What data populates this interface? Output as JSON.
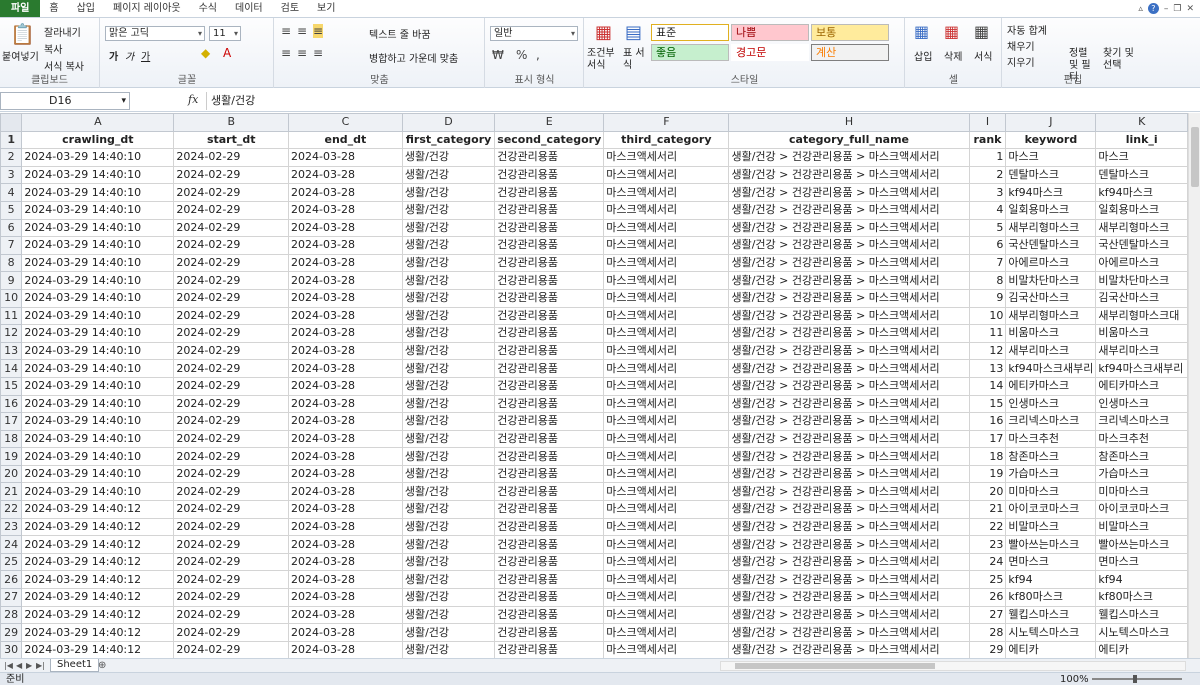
{
  "tabs": [
    "파일",
    "홈",
    "삽입",
    "페이지 레이아웃",
    "수식",
    "데이터",
    "검토",
    "보기"
  ],
  "ribbon": {
    "clipboard": {
      "paste": "붙여넣기",
      "cut": "잘라내기",
      "copy": "복사",
      "format_painter": "서식 복사",
      "label": "클립보드"
    },
    "font": {
      "name": "맑은 고딕",
      "size": "11",
      "bold": "가",
      "italic": "가",
      "underline": "가",
      "label": "글꼴"
    },
    "align": {
      "wrap": "텍스트 줄 바꿈",
      "merge": "병합하고 가운데 맞춤",
      "label": "맞춤"
    },
    "number": {
      "format": "일반",
      "label": "표시 형식"
    },
    "styles": {
      "conditional": "조건부 서식",
      "table": "표 서식",
      "normal": "표준",
      "bad": "나쁨",
      "neutral": "보통",
      "good": "좋음",
      "warning": "경고문",
      "calc": "계산",
      "label": "스타일"
    },
    "cells": {
      "insert": "삽입",
      "delete": "삭제",
      "format": "서식",
      "label": "셀"
    },
    "editing": {
      "autosum": "자동 합계",
      "fill": "채우기",
      "clear": "지우기",
      "sort": "정렬 및 필터",
      "find": "찾기 및 선택",
      "label": "편집"
    }
  },
  "formula_bar": {
    "name_box": "D16",
    "fx": "fx",
    "content": "생활/건강"
  },
  "columns": [
    "A",
    "B",
    "C",
    "D",
    "E",
    "F",
    "H",
    "I",
    "J",
    "K"
  ],
  "header_row": [
    "crawling_dt",
    "start_dt",
    "end_dt",
    "first_category",
    "second_category",
    "third_category",
    "category_full_name",
    "rank",
    "keyword",
    "link_i"
  ],
  "rows": [
    [
      "2024-03-29 14:40:10",
      "2024-02-29",
      "2024-03-28",
      "생활/건강",
      "건강관리용품",
      "마스크액세서리",
      "생활/건강 > 건강관리용품 > 마스크액세서리",
      "1",
      "마스크",
      "마스크"
    ],
    [
      "2024-03-29 14:40:10",
      "2024-02-29",
      "2024-03-28",
      "생활/건강",
      "건강관리용품",
      "마스크액세서리",
      "생활/건강 > 건강관리용품 > 마스크액세서리",
      "2",
      "덴탈마스크",
      "덴탈마스크"
    ],
    [
      "2024-03-29 14:40:10",
      "2024-02-29",
      "2024-03-28",
      "생활/건강",
      "건강관리용품",
      "마스크액세서리",
      "생활/건강 > 건강관리용품 > 마스크액세서리",
      "3",
      "kf94마스크",
      "kf94마스크"
    ],
    [
      "2024-03-29 14:40:10",
      "2024-02-29",
      "2024-03-28",
      "생활/건강",
      "건강관리용품",
      "마스크액세서리",
      "생활/건강 > 건강관리용품 > 마스크액세서리",
      "4",
      "일회용마스크",
      "일회용마스크"
    ],
    [
      "2024-03-29 14:40:10",
      "2024-02-29",
      "2024-03-28",
      "생활/건강",
      "건강관리용품",
      "마스크액세서리",
      "생활/건강 > 건강관리용품 > 마스크액세서리",
      "5",
      "새부리형마스크",
      "새부리형마스크"
    ],
    [
      "2024-03-29 14:40:10",
      "2024-02-29",
      "2024-03-28",
      "생활/건강",
      "건강관리용품",
      "마스크액세서리",
      "생활/건강 > 건강관리용품 > 마스크액세서리",
      "6",
      "국산덴탈마스크",
      "국산덴탈마스크"
    ],
    [
      "2024-03-29 14:40:10",
      "2024-02-29",
      "2024-03-28",
      "생활/건강",
      "건강관리용품",
      "마스크액세서리",
      "생활/건강 > 건강관리용품 > 마스크액세서리",
      "7",
      "아에르마스크",
      "아에르마스크"
    ],
    [
      "2024-03-29 14:40:10",
      "2024-02-29",
      "2024-03-28",
      "생활/건강",
      "건강관리용품",
      "마스크액세서리",
      "생활/건강 > 건강관리용품 > 마스크액세서리",
      "8",
      "비말차단마스크",
      "비말차단마스크"
    ],
    [
      "2024-03-29 14:40:10",
      "2024-02-29",
      "2024-03-28",
      "생활/건강",
      "건강관리용품",
      "마스크액세서리",
      "생활/건강 > 건강관리용품 > 마스크액세서리",
      "9",
      "김국산마스크",
      "김국산마스크"
    ],
    [
      "2024-03-29 14:40:10",
      "2024-02-29",
      "2024-03-28",
      "생활/건강",
      "건강관리용품",
      "마스크액세서리",
      "생활/건강 > 건강관리용품 > 마스크액세서리",
      "10",
      "새부리형마스크",
      "새부리형마스크대"
    ],
    [
      "2024-03-29 14:40:10",
      "2024-02-29",
      "2024-03-28",
      "생활/건강",
      "건강관리용품",
      "마스크액세서리",
      "생활/건강 > 건강관리용품 > 마스크액세서리",
      "11",
      "비움마스크",
      "비움마스크"
    ],
    [
      "2024-03-29 14:40:10",
      "2024-02-29",
      "2024-03-28",
      "생활/건강",
      "건강관리용품",
      "마스크액세서리",
      "생활/건강 > 건강관리용품 > 마스크액세서리",
      "12",
      "새부리마스크",
      "새부리마스크"
    ],
    [
      "2024-03-29 14:40:10",
      "2024-02-29",
      "2024-03-28",
      "생활/건강",
      "건강관리용품",
      "마스크액세서리",
      "생활/건강 > 건강관리용품 > 마스크액세서리",
      "13",
      "kf94마스크새부리",
      "kf94마스크새부리"
    ],
    [
      "2024-03-29 14:40:10",
      "2024-02-29",
      "2024-03-28",
      "생활/건강",
      "건강관리용품",
      "마스크액세서리",
      "생활/건강 > 건강관리용품 > 마스크액세서리",
      "14",
      "에티카마스크",
      "에티카마스크"
    ],
    [
      "2024-03-29 14:40:10",
      "2024-02-29",
      "2024-03-28",
      "생활/건강",
      "건강관리용품",
      "마스크액세서리",
      "생활/건강 > 건강관리용품 > 마스크액세서리",
      "15",
      "인생마스크",
      "인생마스크"
    ],
    [
      "2024-03-29 14:40:10",
      "2024-02-29",
      "2024-03-28",
      "생활/건강",
      "건강관리용품",
      "마스크액세서리",
      "생활/건강 > 건강관리용품 > 마스크액세서리",
      "16",
      "크리넥스마스크",
      "크리넥스마스크"
    ],
    [
      "2024-03-29 14:40:10",
      "2024-02-29",
      "2024-03-28",
      "생활/건강",
      "건강관리용품",
      "마스크액세서리",
      "생활/건강 > 건강관리용품 > 마스크액세서리",
      "17",
      "마스크추천",
      "마스크추천"
    ],
    [
      "2024-03-29 14:40:10",
      "2024-02-29",
      "2024-03-28",
      "생활/건강",
      "건강관리용품",
      "마스크액세서리",
      "생활/건강 > 건강관리용품 > 마스크액세서리",
      "18",
      "참존마스크",
      "참존마스크"
    ],
    [
      "2024-03-29 14:40:10",
      "2024-02-29",
      "2024-03-28",
      "생활/건강",
      "건강관리용품",
      "마스크액세서리",
      "생활/건강 > 건강관리용품 > 마스크액세서리",
      "19",
      "가습마스크",
      "가습마스크"
    ],
    [
      "2024-03-29 14:40:10",
      "2024-02-29",
      "2024-03-28",
      "생활/건강",
      "건강관리용품",
      "마스크액세서리",
      "생활/건강 > 건강관리용품 > 마스크액세서리",
      "20",
      "미마마스크",
      "미마마스크"
    ],
    [
      "2024-03-29 14:40:12",
      "2024-02-29",
      "2024-03-28",
      "생활/건강",
      "건강관리용품",
      "마스크액세서리",
      "생활/건강 > 건강관리용품 > 마스크액세서리",
      "21",
      "아이코코마스크",
      "아이코코마스크"
    ],
    [
      "2024-03-29 14:40:12",
      "2024-02-29",
      "2024-03-28",
      "생활/건강",
      "건강관리용품",
      "마스크액세서리",
      "생활/건강 > 건강관리용품 > 마스크액세서리",
      "22",
      "비말마스크",
      "비말마스크"
    ],
    [
      "2024-03-29 14:40:12",
      "2024-02-29",
      "2024-03-28",
      "생활/건강",
      "건강관리용품",
      "마스크액세서리",
      "생활/건강 > 건강관리용품 > 마스크액세서리",
      "23",
      "빨아쓰는마스크",
      "빨아쓰는마스크"
    ],
    [
      "2024-03-29 14:40:12",
      "2024-02-29",
      "2024-03-28",
      "생활/건강",
      "건강관리용품",
      "마스크액세서리",
      "생활/건강 > 건강관리용품 > 마스크액세서리",
      "24",
      "면마스크",
      "면마스크"
    ],
    [
      "2024-03-29 14:40:12",
      "2024-02-29",
      "2024-03-28",
      "생활/건강",
      "건강관리용품",
      "마스크액세서리",
      "생활/건강 > 건강관리용품 > 마스크액세서리",
      "25",
      "kf94",
      "kf94"
    ],
    [
      "2024-03-29 14:40:12",
      "2024-02-29",
      "2024-03-28",
      "생활/건강",
      "건강관리용품",
      "마스크액세서리",
      "생활/건강 > 건강관리용품 > 마스크액세서리",
      "26",
      "kf80마스크",
      "kf80마스크"
    ],
    [
      "2024-03-29 14:40:12",
      "2024-02-29",
      "2024-03-28",
      "생활/건강",
      "건강관리용품",
      "마스크액세서리",
      "생활/건강 > 건강관리용품 > 마스크액세서리",
      "27",
      "웰킵스마스크",
      "웰킵스마스크"
    ],
    [
      "2024-03-29 14:40:12",
      "2024-02-29",
      "2024-03-28",
      "생활/건강",
      "건강관리용품",
      "마스크액세서리",
      "생활/건강 > 건강관리용품 > 마스크액세서리",
      "28",
      "시노텍스마스크",
      "시노텍스마스크"
    ],
    [
      "2024-03-29 14:40:12",
      "2024-02-29",
      "2024-03-28",
      "생활/건강",
      "건강관리용품",
      "마스크액세서리",
      "생활/건강 > 건강관리용품 > 마스크액세서리",
      "29",
      "에티카",
      "에티카"
    ]
  ],
  "sheet": {
    "name": "Sheet1"
  },
  "status": {
    "ready": "준비",
    "zoom": "100%"
  }
}
